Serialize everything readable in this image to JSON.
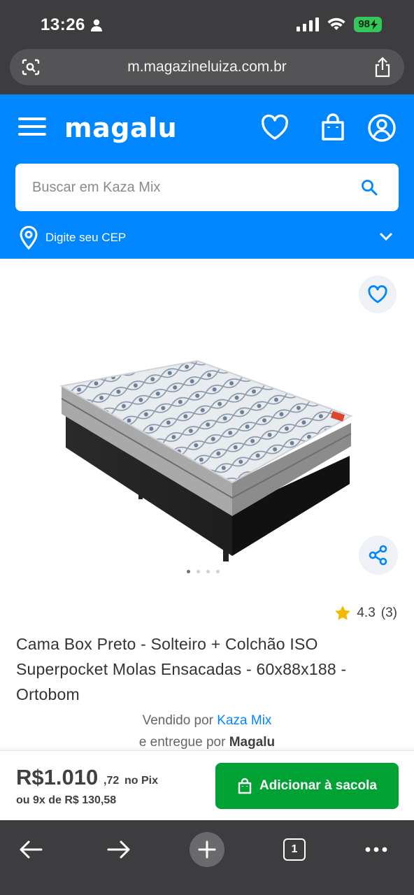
{
  "status_bar": {
    "time": "13:26",
    "battery": "98"
  },
  "browser": {
    "url": "m.magazineluiza.com.br",
    "tabs_count": "1"
  },
  "header": {
    "logo": "magalu",
    "search_placeholder": "Buscar em Kaza Mix",
    "cep_label": "Digite seu CEP"
  },
  "product": {
    "rating": "4.3",
    "rating_count": "(3)",
    "title": "Cama Box Preto - Solteiro + Colchão ISO Superpocket Molas Ensacadas - 60x88x188 - Ortobom",
    "sold_by_prefix": "Vendido por",
    "seller": "Kaza Mix",
    "delivered_by_prefix": "e entregue por",
    "delivered_by": "Magalu",
    "image_count": 4,
    "active_image": 1
  },
  "purchase": {
    "price_main": "R$1.010",
    "price_cents": ",72",
    "price_method": "no Pix",
    "installments": "ou 9x de R$ 130,58",
    "add_button": "Adicionar à sacola"
  },
  "colors": {
    "brand_blue": "#0086ff",
    "buy_green": "#00a233",
    "ios_gray": "#3d3d3f"
  }
}
